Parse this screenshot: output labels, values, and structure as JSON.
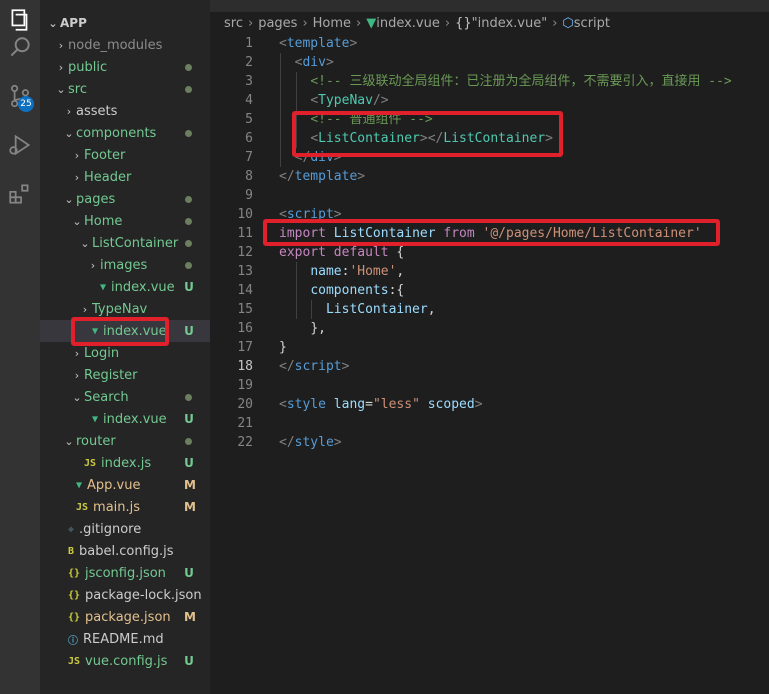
{
  "explorer": {
    "root": "APP",
    "items": [
      {
        "label": "node_modules",
        "chevron": "›",
        "status": "",
        "color": "#8c8c8c",
        "icon": ""
      },
      {
        "label": "public",
        "chevron": "›",
        "status": "dot",
        "color": "#73c991",
        "icon": ""
      },
      {
        "label": "src",
        "chevron": "⌄",
        "status": "dot",
        "color": "#73c991",
        "icon": ""
      },
      {
        "label": "assets",
        "chevron": "›",
        "status": "",
        "color": "#cccccc",
        "icon": ""
      },
      {
        "label": "components",
        "chevron": "⌄",
        "status": "dot",
        "color": "#73c991",
        "icon": ""
      },
      {
        "label": "Footer",
        "chevron": "›",
        "status": "",
        "color": "#73c991",
        "icon": ""
      },
      {
        "label": "Header",
        "chevron": "›",
        "status": "",
        "color": "#73c991",
        "icon": ""
      },
      {
        "label": "pages",
        "chevron": "⌄",
        "status": "dot",
        "color": "#73c991",
        "icon": ""
      },
      {
        "label": "Home",
        "chevron": "⌄",
        "status": "dot",
        "color": "#73c991",
        "icon": ""
      },
      {
        "label": "ListContainer",
        "chevron": "⌄",
        "status": "dot",
        "color": "#73c991",
        "icon": ""
      },
      {
        "label": "images",
        "chevron": "›",
        "status": "dot",
        "color": "#73c991",
        "icon": ""
      },
      {
        "label": "index.vue",
        "chevron": "",
        "status": "U",
        "color": "#73c991",
        "icon": "vue"
      },
      {
        "label": "TypeNav",
        "chevron": "›",
        "status": "",
        "color": "#73c991",
        "icon": ""
      },
      {
        "label": "index.vue",
        "chevron": "",
        "status": "U",
        "color": "#73c991",
        "icon": "vue"
      },
      {
        "label": "Login",
        "chevron": "›",
        "status": "",
        "color": "#73c991",
        "icon": ""
      },
      {
        "label": "Register",
        "chevron": "›",
        "status": "",
        "color": "#73c991",
        "icon": ""
      },
      {
        "label": "Search",
        "chevron": "⌄",
        "status": "dot",
        "color": "#73c991",
        "icon": ""
      },
      {
        "label": "index.vue",
        "chevron": "",
        "status": "U",
        "color": "#73c991",
        "icon": "vue"
      },
      {
        "label": "router",
        "chevron": "⌄",
        "status": "dot",
        "color": "#73c991",
        "icon": ""
      },
      {
        "label": "index.js",
        "chevron": "",
        "status": "U",
        "color": "#73c991",
        "icon": "js"
      },
      {
        "label": "App.vue",
        "chevron": "",
        "status": "M",
        "color": "#e2c08d",
        "icon": "vue"
      },
      {
        "label": "main.js",
        "chevron": "",
        "status": "M",
        "color": "#e2c08d",
        "icon": "js"
      },
      {
        "label": ".gitignore",
        "chevron": "",
        "status": "",
        "color": "#cccccc",
        "icon": "git"
      },
      {
        "label": "babel.config.js",
        "chevron": "",
        "status": "",
        "color": "#cccccc",
        "icon": "babel"
      },
      {
        "label": "jsconfig.json",
        "chevron": "",
        "status": "U",
        "color": "#73c991",
        "icon": "json"
      },
      {
        "label": "package-lock.json",
        "chevron": "",
        "status": "",
        "color": "#cccccc",
        "icon": "json"
      },
      {
        "label": "package.json",
        "chevron": "",
        "status": "M",
        "color": "#e2c08d",
        "icon": "json"
      },
      {
        "label": "README.md",
        "chevron": "",
        "status": "",
        "color": "#cccccc",
        "icon": "info"
      },
      {
        "label": "vue.config.js",
        "chevron": "",
        "status": "U",
        "color": "#73c991",
        "icon": "js"
      }
    ]
  },
  "activity": {
    "scm_badge": "25"
  },
  "icons": {
    "vue": "▼",
    "js": "JS",
    "json": "{}",
    "info": "ⓘ",
    "git": "◆",
    "babel": "B"
  },
  "breadcrumb": {
    "parts": [
      "src",
      "pages",
      "Home"
    ],
    "file": "index.vue",
    "symbol1": "\"index.vue\"",
    "symbol2": "script"
  },
  "code": {
    "active_line": 18,
    "lines": [
      {
        "n": "1",
        "tokens": [
          [
            "t-punct",
            "<"
          ],
          [
            "t-tag",
            "template"
          ],
          [
            "t-punct",
            ">"
          ]
        ]
      },
      {
        "n": "2",
        "tokens": [
          [
            "t-plain",
            "  "
          ],
          [
            "t-punct",
            "<"
          ],
          [
            "t-tag",
            "div"
          ],
          [
            "t-punct",
            ">"
          ]
        ]
      },
      {
        "n": "3",
        "tokens": [
          [
            "t-plain",
            "    "
          ],
          [
            "t-comment",
            "<!-- 三级联动全局组件：已注册为全局组件，不需要引入，直接用 -->"
          ]
        ]
      },
      {
        "n": "4",
        "tokens": [
          [
            "t-plain",
            "    "
          ],
          [
            "t-punct",
            "<"
          ],
          [
            "t-comp",
            "TypeNav"
          ],
          [
            "t-punct",
            "/>"
          ]
        ]
      },
      {
        "n": "5",
        "tokens": [
          [
            "t-plain",
            "    "
          ],
          [
            "t-comment",
            "<!-- 普通组件 -->"
          ]
        ]
      },
      {
        "n": "6",
        "tokens": [
          [
            "t-plain",
            "    "
          ],
          [
            "t-punct",
            "<"
          ],
          [
            "t-comp",
            "ListContainer"
          ],
          [
            "t-punct",
            "></"
          ],
          [
            "t-comp",
            "ListContainer"
          ],
          [
            "t-punct",
            ">"
          ]
        ]
      },
      {
        "n": "7",
        "tokens": [
          [
            "t-plain",
            "  "
          ],
          [
            "t-punct",
            "</"
          ],
          [
            "t-tag",
            "div"
          ],
          [
            "t-punct",
            ">"
          ]
        ]
      },
      {
        "n": "8",
        "tokens": [
          [
            "t-punct",
            "</"
          ],
          [
            "t-tag",
            "template"
          ],
          [
            "t-punct",
            ">"
          ]
        ]
      },
      {
        "n": "9",
        "tokens": []
      },
      {
        "n": "10",
        "tokens": [
          [
            "t-punct",
            "<"
          ],
          [
            "t-tag",
            "script"
          ],
          [
            "t-punct",
            ">"
          ]
        ]
      },
      {
        "n": "11",
        "tokens": [
          [
            "t-kw",
            "import"
          ],
          [
            "t-plain",
            " "
          ],
          [
            "t-var",
            "ListContainer"
          ],
          [
            "t-plain",
            " "
          ],
          [
            "t-kw",
            "from"
          ],
          [
            "t-plain",
            " "
          ],
          [
            "t-str",
            "'@/pages/Home/ListContainer'"
          ]
        ]
      },
      {
        "n": "12",
        "tokens": [
          [
            "t-kw",
            "export"
          ],
          [
            "t-plain",
            " "
          ],
          [
            "t-kw",
            "default"
          ],
          [
            "t-plain",
            " {"
          ]
        ]
      },
      {
        "n": "13",
        "tokens": [
          [
            "t-plain",
            "    "
          ],
          [
            "t-var",
            "name"
          ],
          [
            "t-plain",
            ":"
          ],
          [
            "t-str",
            "'Home'"
          ],
          [
            "t-plain",
            ","
          ]
        ]
      },
      {
        "n": "14",
        "tokens": [
          [
            "t-plain",
            "    "
          ],
          [
            "t-var",
            "components"
          ],
          [
            "t-plain",
            ":{"
          ]
        ]
      },
      {
        "n": "15",
        "tokens": [
          [
            "t-plain",
            "      "
          ],
          [
            "t-var",
            "ListContainer"
          ],
          [
            "t-plain",
            ","
          ]
        ]
      },
      {
        "n": "16",
        "tokens": [
          [
            "t-plain",
            "    "
          ],
          [
            "t-plain",
            "},"
          ]
        ]
      },
      {
        "n": "17",
        "tokens": [
          [
            "t-plain",
            "}"
          ]
        ]
      },
      {
        "n": "18",
        "tokens": [
          [
            "t-punct",
            "</"
          ],
          [
            "t-tag",
            "script"
          ],
          [
            "t-punct",
            ">"
          ]
        ]
      },
      {
        "n": "19",
        "tokens": []
      },
      {
        "n": "20",
        "tokens": [
          [
            "t-punct",
            "<"
          ],
          [
            "t-tag",
            "style"
          ],
          [
            "t-plain",
            " "
          ],
          [
            "t-attr",
            "lang"
          ],
          [
            "t-plain",
            "="
          ],
          [
            "t-str",
            "\"less\""
          ],
          [
            "t-plain",
            " "
          ],
          [
            "t-attr",
            "scoped"
          ],
          [
            "t-punct",
            ">"
          ]
        ]
      },
      {
        "n": "21",
        "tokens": []
      },
      {
        "n": "22",
        "tokens": [
          [
            "t-punct",
            "</"
          ],
          [
            "t-tag",
            "style"
          ],
          [
            "t-punct",
            ">"
          ]
        ]
      }
    ]
  }
}
